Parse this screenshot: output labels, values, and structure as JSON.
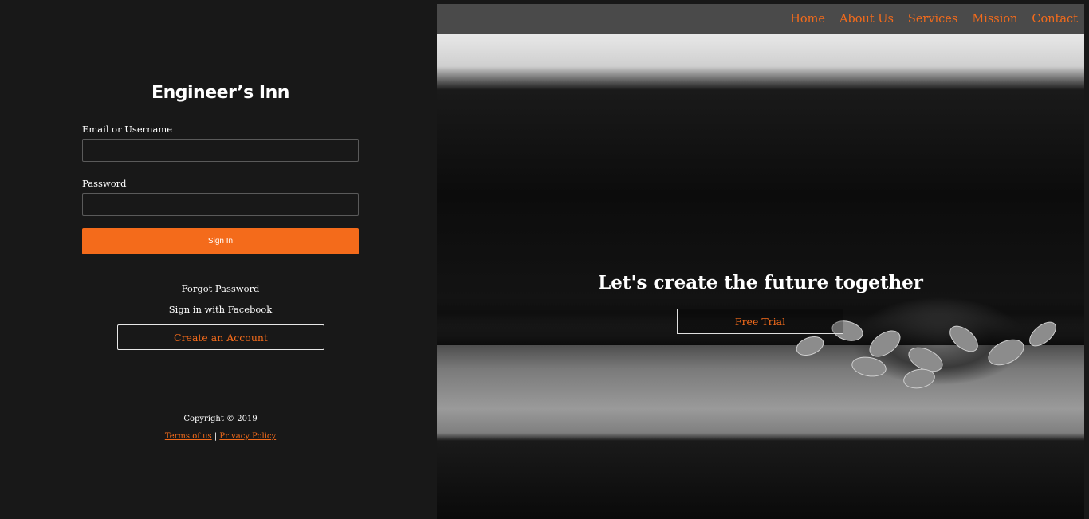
{
  "brand": {
    "title": "Engineer’s Inn"
  },
  "login": {
    "email_label": "Email or Username",
    "email_value": "",
    "password_label": "Password",
    "password_value": "",
    "signin_label": "Sign In",
    "forgot_label": "Forgot Password",
    "facebook_label": "Sign in with Facebook",
    "create_label": "Create an Account"
  },
  "footer": {
    "copyright": "Copyright © 2019",
    "terms_label": "Terms of us",
    "separator": "|",
    "privacy_label": "Privacy Policy"
  },
  "nav": {
    "items": [
      {
        "label": "Home"
      },
      {
        "label": "About Us"
      },
      {
        "label": "Services"
      },
      {
        "label": "Mission"
      },
      {
        "label": "Contact"
      }
    ]
  },
  "hero": {
    "headline": "Let's create the future together",
    "cta_label": "Free Trial"
  },
  "colors": {
    "accent": "#f46b1b",
    "background": "#181818",
    "navbar": "#4a4a4a"
  }
}
